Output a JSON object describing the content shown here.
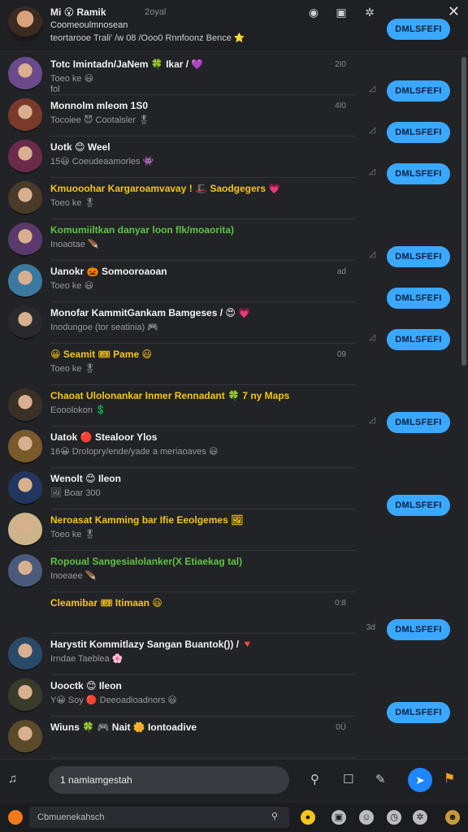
{
  "header": {
    "name": "Mi 😮 Ramik",
    "time": "2oyal",
    "subtitle_1": "Coomeoulmnosean",
    "subtitle_2": "teortarooe Trali' /w 08 /Ooo0 Rnnfoonz Bence ⭐",
    "button_label": "DMLSFEFI",
    "icons": [
      "globe-icon",
      "image-icon",
      "gear-icon",
      "close-icon"
    ]
  },
  "rows": [
    {
      "title": "Totc Imintadn/JaNem 🍀 Ikar / 💜",
      "subtitle": "Toeo ke 😃",
      "extra": "fol",
      "meta": "2I0",
      "mark": "◿",
      "button": "DMLSFEFI",
      "title_color": "#f2f2f2",
      "avatar": "#6a4a8a"
    },
    {
      "title": "Monnolm mleom 1S0",
      "subtitle": "Tocoiee 😈 Cootalsler 🎖",
      "extra": "",
      "meta": "4I0",
      "mark": "◿",
      "button": "DMLSFEFI",
      "title_color": "#f2f2f2",
      "avatar": "#7a3a2a"
    },
    {
      "title": "Uotk 😊 Weel",
      "subtitle": "15😃 Coeudeaamorles 👾",
      "extra": "",
      "meta": "",
      "mark": "◿",
      "button": "DMLSFEFI",
      "title_color": "#f2f2f2",
      "avatar": "#6a2a4a"
    },
    {
      "title": "Kmuooohar Kargaroamvavay ! 🎩 Saodgegers 💗",
      "subtitle": "Toeo ke 🎖",
      "extra": "",
      "meta": "",
      "mark": "",
      "button": "",
      "title_color": "#f5c518",
      "avatar": "#4a3a2a"
    },
    {
      "title": "Komumiiltkan danyar loon flk/moaorita)",
      "subtitle": "Inoaotae 🪶",
      "extra": "",
      "meta": "",
      "mark": "◿",
      "button": "DMLSFEFI",
      "title_color": "#5ec443",
      "avatar": "#5a3a6a"
    },
    {
      "title": "Uanokr 🎃 Somooroaoan",
      "subtitle": "Toeo ke 😃",
      "extra": "",
      "meta": "ad",
      "mark": "",
      "button": "DMLSFEFI",
      "title_color": "#f2f2f2",
      "avatar": "#3a7aa0"
    },
    {
      "title": "Monofar KammitGankam Bamgeses / 😍 💗",
      "subtitle": "Inodungoe (tor seatinia) 🎮",
      "extra": "",
      "meta": "",
      "mark": "◿",
      "button": "DMLSFEFI",
      "title_color": "#f2f2f2",
      "avatar": "#2a2a2e"
    },
    {
      "title": "😀 Seamit 🎟 Pame 😃",
      "subtitle": "Toeo ke 🎖",
      "extra": "",
      "meta": "09",
      "mark": "",
      "button": "",
      "title_color": "#f5c518",
      "avatar": ""
    },
    {
      "title": "Chaoat Ulolonankar Inmer Rennadant 🍀 7 ny Maps",
      "subtitle": "Eooolokon 💲",
      "extra": "",
      "meta": "",
      "mark": "◿",
      "button": "DMLSFEFI",
      "title_color": "#f5c518",
      "avatar": "#3a3026"
    },
    {
      "title": "Uatok 🔴 Stealoor Ylos",
      "subtitle": "16😀 Drolopry/ende/yade a meriaoaves 😃",
      "extra": "",
      "meta": "",
      "mark": "",
      "button": "",
      "title_color": "#f2f2f2",
      "avatar": "#7a5a2a"
    },
    {
      "title": "Wenolt 😊 Ileon",
      "subtitle": "🖼 Boar 300",
      "extra": "",
      "meta": "",
      "mark": "",
      "button": "DMLSFEFI",
      "title_color": "#f2f2f2",
      "avatar": "#22365e"
    },
    {
      "title": "Neroasat Kamming bar Ifie Eeolgemes 🖼",
      "subtitle": "Toeo ke 🎖",
      "extra": "",
      "meta": "",
      "mark": "",
      "button": "",
      "title_color": "#f5c518",
      "avatar": "#cdb48a"
    },
    {
      "title": "Ropoual Sangesialolanker(X Etiaekag tal)",
      "subtitle": "Inoeaee 🪶",
      "extra": "",
      "meta": "",
      "mark": "",
      "button": "",
      "title_color": "#5ec443",
      "avatar": "#4a5a7a"
    },
    {
      "title": "Cleamibar 🎟 Itimaan 😃",
      "subtitle": "",
      "extra": "",
      "meta": "0:8",
      "mark": "3d",
      "button": "DMLSFEFI",
      "title_color": "#f5c518",
      "avatar": ""
    },
    {
      "title": "Harystit Kommitlazy Sangan Buantok()) / 🔻",
      "subtitle": "Irndae Taeblea 🌸",
      "extra": "",
      "meta": "",
      "mark": "",
      "button": "",
      "title_color": "#f2f2f2",
      "avatar": "#2a4a6a"
    },
    {
      "title": "Uooctk 😊 Ileon",
      "subtitle": "Y😀 Soy 🔴 Deeoadioadnors 😃",
      "extra": "",
      "meta": "",
      "mark": "",
      "button": "DMLSFEFI",
      "title_color": "#f2f2f2",
      "avatar": "#3a3a2a"
    },
    {
      "title": "Wiuns 🍀 🎮 Nait 🌼 Iontoadive",
      "subtitle": "",
      "extra": "",
      "meta": "0Ü",
      "mark": "",
      "button": "",
      "title_color": "#f2f2f2",
      "avatar": "#5a4a2a"
    }
  ],
  "compose": {
    "placeholder": "1 namlamgestah"
  },
  "bottom": {
    "search_placeholder": "Cbmuenekahsch"
  }
}
